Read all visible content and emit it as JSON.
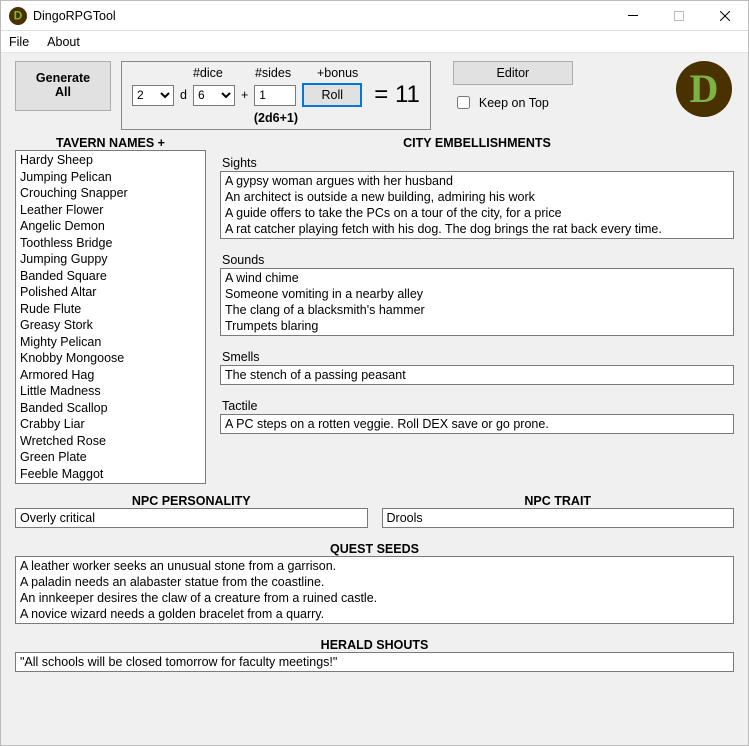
{
  "window": {
    "title": "DingoRPGTool"
  },
  "menu": {
    "file": "File",
    "about": "About"
  },
  "buttons": {
    "generate_all": "Generate\nAll",
    "roll": "Roll",
    "editor": "Editor"
  },
  "dice": {
    "labels": {
      "dice": "#dice",
      "sides": "#sides",
      "bonus": "+bonus"
    },
    "ndice": "2",
    "d": "d",
    "nsides": "6",
    "plus": "+",
    "bonus": "1",
    "eq": "= 11",
    "formula": "(2d6+1)"
  },
  "keep_on_top": {
    "label": "Keep on Top",
    "checked": false
  },
  "headers": {
    "tavern": "TAVERN NAMES    +",
    "city_emb": "CITY EMBELLISHMENTS",
    "sights": "Sights",
    "sounds": "Sounds",
    "smells": "Smells",
    "tactile": "Tactile",
    "npc_personality": "NPC PERSONALITY",
    "npc_trait": "NPC TRAIT",
    "quest_seeds": "QUEST SEEDS",
    "herald": "HERALD SHOUTS"
  },
  "tavern_names": [
    "Hardy Sheep",
    "Jumping Pelican",
    "Crouching Snapper",
    "Leather Flower",
    "Angelic Demon",
    "Toothless Bridge",
    "Jumping Guppy",
    "Banded Square",
    "Polished Altar",
    "Rude Flute",
    "Greasy Stork",
    "Mighty Pelican",
    "Knobby Mongoose",
    "Armored Hag",
    "Little Madness",
    "Banded Scallop",
    "Crabby Liar",
    "Wretched Rose",
    "Green Plate",
    "Feeble Maggot"
  ],
  "sights": [
    "A gypsy woman argues with her husband",
    "An architect is outside a new building, admiring his work",
    "A guide offers to take the PCs on a tour of the city, for a price",
    "A rat catcher playing fetch with his dog. The dog brings the rat back every time."
  ],
  "sounds": [
    "A wind chime",
    "Someone vomiting in a nearby alley",
    "The clang of a blacksmith's hammer",
    "Trumpets blaring"
  ],
  "smells": "The stench of a passing peasant",
  "tactile": "A PC steps on a rotten veggie. Roll DEX save or go prone.",
  "npc_personality": "Overly critical",
  "npc_trait": "Drools",
  "quest_seeds": [
    "A leather worker seeks an unusual stone from a garrison.",
    "A paladin needs an alabaster statue from the coastline.",
    "An innkeeper desires the claw of a creature from a ruined castle.",
    "A novice wizard needs a golden bracelet from a quarry."
  ],
  "herald": "\"All schools will be closed tomorrow for faculty meetings!\""
}
